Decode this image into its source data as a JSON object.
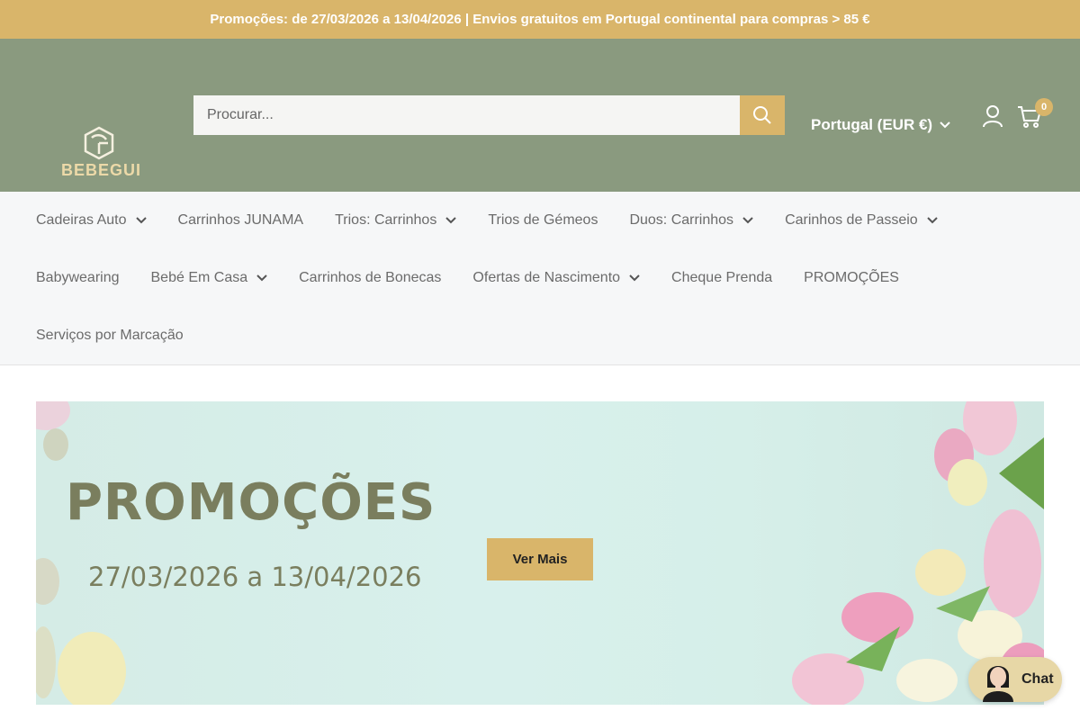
{
  "announcement": "Promoções: de 27/03/2026 a 13/04/2026 | Envios gratuitos em Portugal continental para compras > 85 €",
  "header": {
    "logo_text": "BEBEGUI",
    "search_placeholder": "Procurar...",
    "country_selector": "Portugal (EUR €)",
    "cart_count": "0"
  },
  "nav": {
    "row1": [
      "Cadeiras Auto",
      "Carrinhos JUNAMA",
      "Trios: Carrinhos",
      "Trios de Gémeos",
      "Duos: Carrinhos",
      "Carinhos de Passeio"
    ],
    "row2": [
      "Babywearing",
      "Bebé Em Casa",
      "Carrinhos de Bonecas",
      "Ofertas de Nascimento",
      "Cheque Prenda",
      "PROMOÇÕES"
    ],
    "row3": [
      "Serviços por Marcação"
    ]
  },
  "hero": {
    "title": "PROMOÇÕES",
    "dates": "27/03/2026 a 13/04/2026",
    "button": "Ver Mais"
  },
  "chat": {
    "label": "Chat"
  },
  "colors": {
    "accent": "#d9b56a",
    "header_bg": "#8a9a7f",
    "nav_bg": "#f6f7f8"
  }
}
